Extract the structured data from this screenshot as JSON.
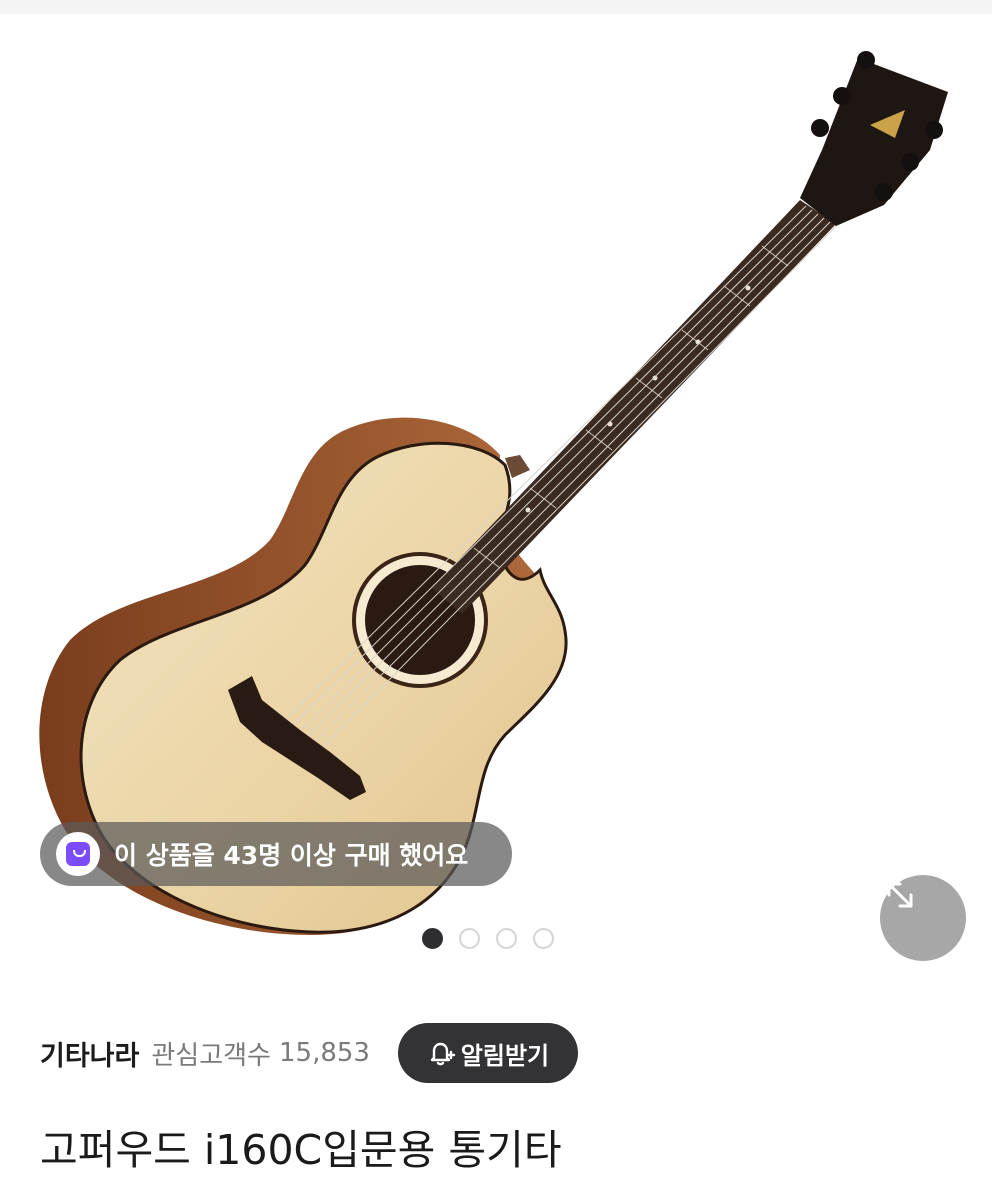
{
  "product_gallery": {
    "image_alt": "acoustic-guitar-photo",
    "purchase_badge": {
      "text": "이 상품을 43명 이상 구매 했어요",
      "icon": "shopping-bag-icon",
      "icon_color": "#7c4dff"
    },
    "pagination": {
      "total": 4,
      "current": 1
    },
    "expand_icon": "expand-arrows-icon"
  },
  "seller": {
    "name": "기타나라",
    "follower_label": "관심고객수",
    "follower_count": "15,853",
    "notify_button": {
      "label": "알림받기",
      "icon": "bell-plus-icon"
    }
  },
  "product": {
    "title": "고퍼우드 i160C입문용 통기타"
  }
}
